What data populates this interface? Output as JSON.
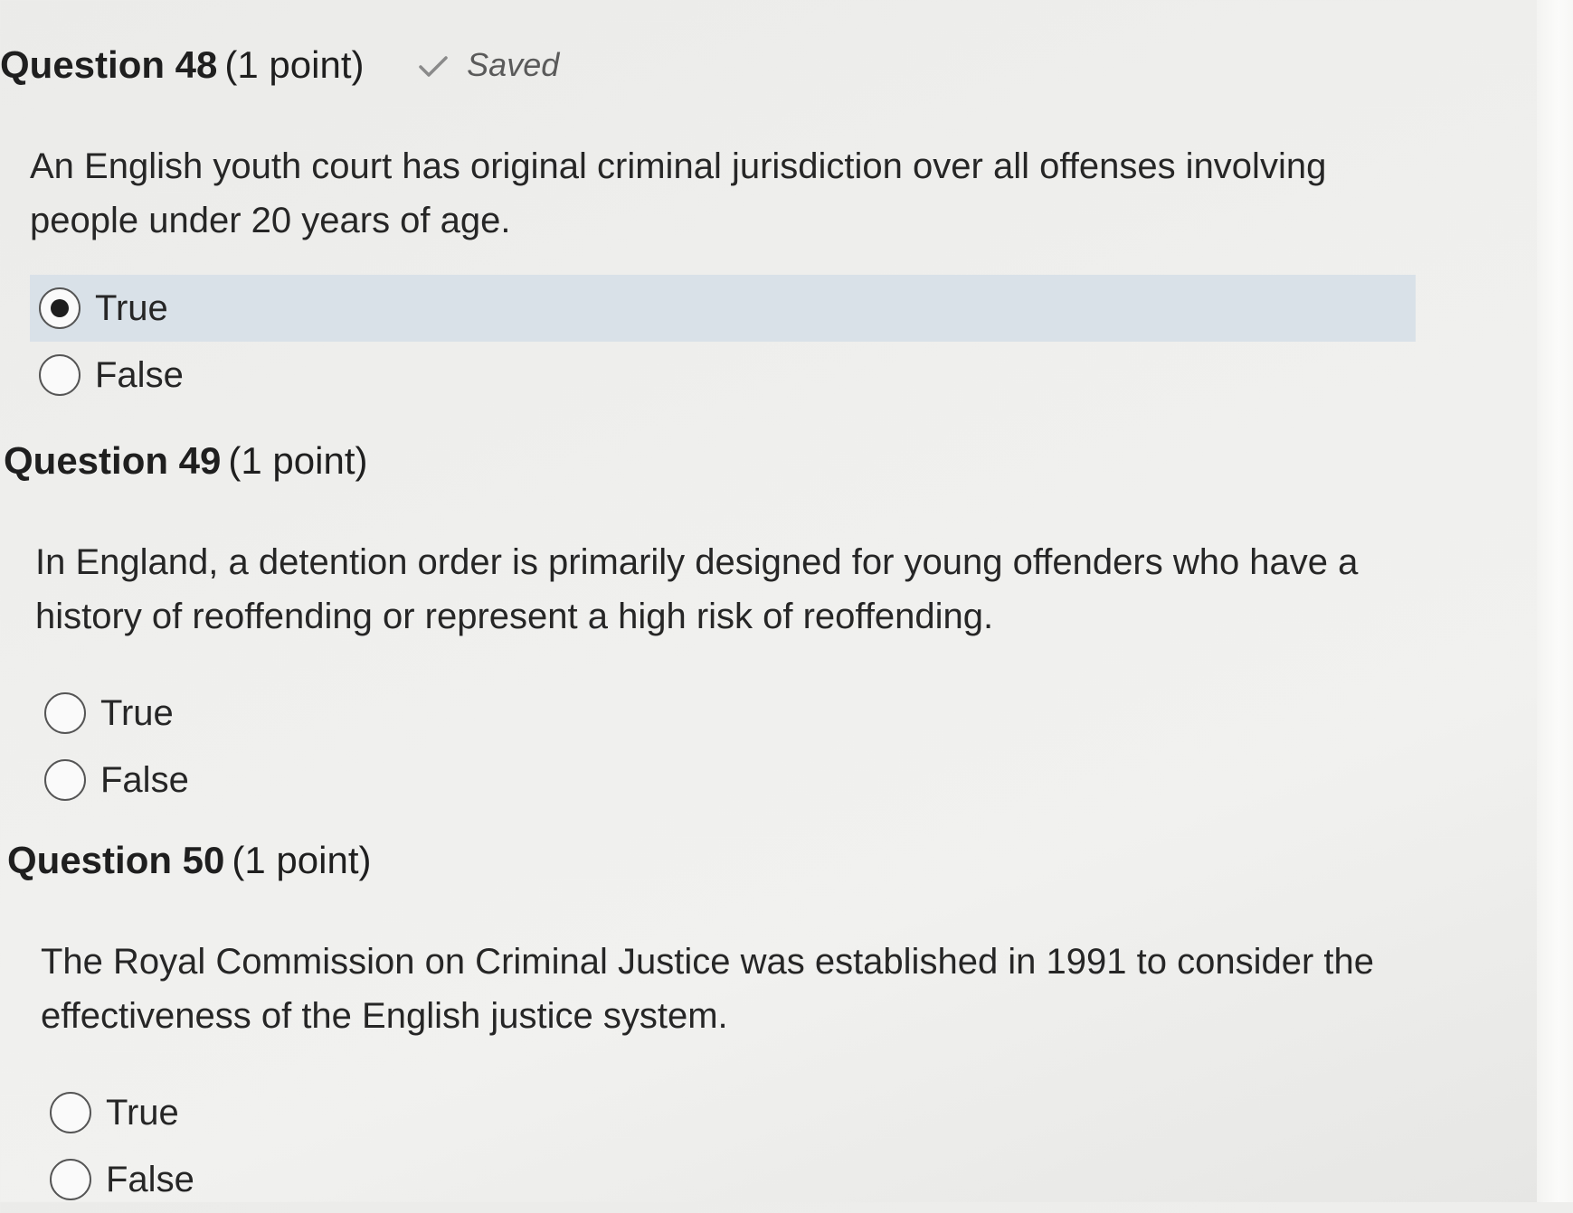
{
  "questions": [
    {
      "number": "Question 48",
      "points": "(1 point)",
      "status": "Saved",
      "text": "An English youth court has original criminal jurisdiction over all offenses involving people under 20 years of age.",
      "options": [
        "True",
        "False"
      ],
      "selected": "True"
    },
    {
      "number": "Question 49",
      "points": "(1 point)",
      "text": "In England, a detention order is primarily designed for young offenders who have a history of reoffending or represent a high risk of reoffending.",
      "options": [
        "True",
        "False"
      ],
      "selected": null
    },
    {
      "number": "Question 50",
      "points": "(1 point)",
      "text": "The Royal Commission on Criminal Justice was established in 1991 to consider the effectiveness of the English justice system.",
      "options": [
        "True",
        "False"
      ],
      "selected": null
    }
  ],
  "icons": {
    "saved": "check-icon",
    "radio_selected": "radio-selected-icon",
    "radio_unselected": "radio-unselected-icon"
  },
  "colors": {
    "selected_row_bg": "#d9e1e8",
    "saved_text": "#5a5a5a",
    "check": "#8a8a8a"
  }
}
